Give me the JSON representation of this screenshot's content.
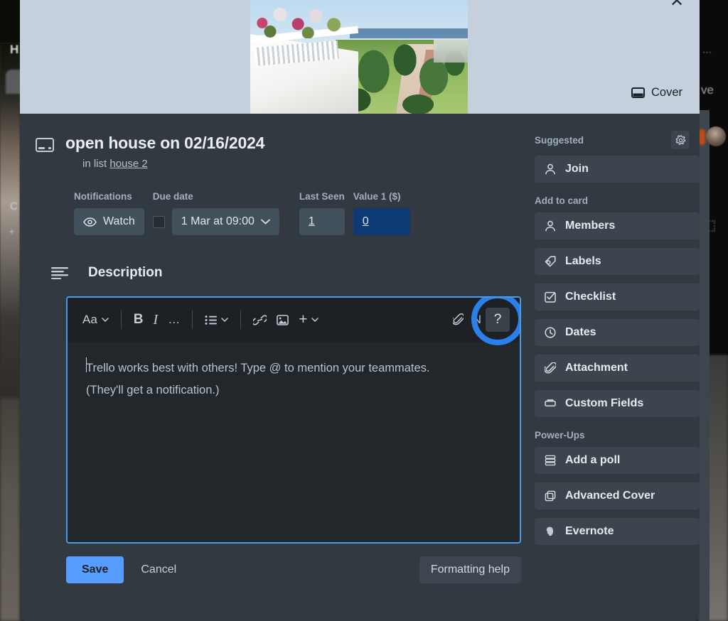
{
  "cover": {
    "close_icon": "close-icon",
    "button_label": "Cover",
    "button_icon": "cover-icon"
  },
  "card": {
    "icon": "card-icon",
    "title": "open house on 02/16/2024",
    "in_list_prefix": "in list",
    "list_name": "house 2"
  },
  "fields": [
    {
      "label": "Notifications",
      "value": "Watch",
      "icon": "eye-icon",
      "style": "normal"
    },
    {
      "label": "Due date",
      "value": "1 Mar at 09:00",
      "icon": "chevron-down-icon",
      "style": "normal",
      "checkbox": true
    },
    {
      "label": "Last Seen",
      "value": "1",
      "style": "underline"
    },
    {
      "label": "Value 1 ($)",
      "value": "0",
      "style": "highlight"
    }
  ],
  "description": {
    "heading": "Description",
    "heading_icon": "description-lines-icon",
    "placeholder_line1": "Trello works best with others! Type @ to mention your teammates.",
    "placeholder_line2": "(They'll get a notification.)",
    "toolbar": [
      {
        "name": "text-style-dropdown",
        "label": "Aa",
        "caret": true
      },
      {
        "name": "bold-button",
        "label": "B"
      },
      {
        "name": "italic-button",
        "label": "I"
      },
      {
        "name": "more-formatting-button",
        "label": "…"
      },
      {
        "name": "list-dropdown",
        "label": "list",
        "caret": true
      },
      {
        "name": "link-button",
        "label": "link"
      },
      {
        "name": "image-button",
        "label": "image"
      },
      {
        "name": "insert-dropdown",
        "label": "+",
        "caret": true
      },
      {
        "name": "attachment-button",
        "label": "attachment"
      },
      {
        "name": "nbtn",
        "label": "N"
      },
      {
        "name": "help-button",
        "label": "?"
      }
    ],
    "save_label": "Save",
    "cancel_label": "Cancel",
    "formatting_help_label": "Formatting help"
  },
  "sidebar": {
    "suggested_title": "Suggested",
    "gear_icon": "gear-icon",
    "suggested_items": [
      {
        "label": "Join",
        "icon": "person-icon"
      }
    ],
    "add_to_card_title": "Add to card",
    "add_to_card_items": [
      {
        "label": "Members",
        "icon": "person-icon"
      },
      {
        "label": "Labels",
        "icon": "label-tag-icon"
      },
      {
        "label": "Checklist",
        "icon": "checkbox-icon"
      },
      {
        "label": "Dates",
        "icon": "clock-icon"
      },
      {
        "label": "Attachment",
        "icon": "paperclip-icon"
      },
      {
        "label": "Custom Fields",
        "icon": "custom-fields-icon"
      }
    ],
    "power_ups_title": "Power-Ups",
    "power_ups_items": [
      {
        "label": "Add a poll",
        "icon": "poll-icon"
      },
      {
        "label": "Advanced Cover",
        "icon": "copy-icon"
      },
      {
        "label": "Evernote",
        "icon": "evernote-elephant-icon"
      }
    ]
  },
  "colors": {
    "modal_bg": "#323940",
    "cover_bg": "#c6d0dc",
    "chip_bg": "#42505c",
    "highlight_chip_bg": "#0d3a74",
    "editor_border": "#4a9ae8",
    "annotation_ring": "#2b7fe8",
    "save_button": "#579dff"
  },
  "background": {
    "dots": "⋯",
    "ve_fragment": "ve",
    "h_fragment": "H",
    "c_fragment": "C",
    "plus_fragment": "+"
  }
}
